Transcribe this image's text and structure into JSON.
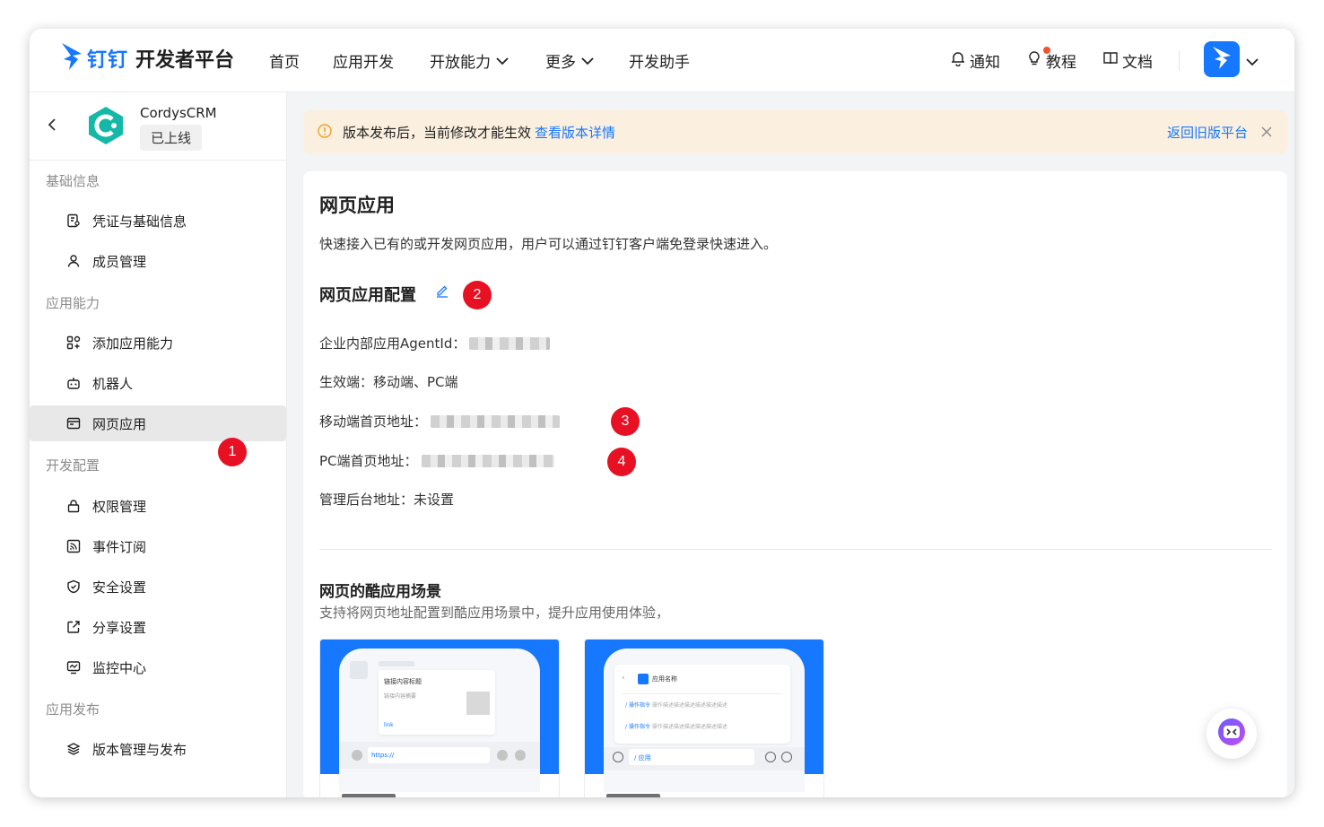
{
  "topnav": {
    "brand": "钉钉",
    "platform": "开发者平台",
    "items": [
      {
        "label": "首页"
      },
      {
        "label": "应用开发"
      },
      {
        "label": "开放能力"
      },
      {
        "label": "更多"
      },
      {
        "label": "开发助手"
      }
    ],
    "right": {
      "notify": "通知",
      "tutorial": "教程",
      "docs": "文档"
    }
  },
  "sidebar": {
    "app_name": "CordysCRM",
    "app_status": "已上线",
    "sections": [
      {
        "title": "基础信息",
        "items": [
          {
            "label": "凭证与基础信息",
            "icon": "credential-icon"
          },
          {
            "label": "成员管理",
            "icon": "user-icon"
          }
        ]
      },
      {
        "title": "应用能力",
        "items": [
          {
            "label": "添加应用能力",
            "icon": "apps-add-icon"
          },
          {
            "label": "机器人",
            "icon": "robot-icon"
          },
          {
            "label": "网页应用",
            "icon": "browser-icon"
          }
        ]
      },
      {
        "title": "开发配置",
        "items": [
          {
            "label": "权限管理",
            "icon": "lock-icon"
          },
          {
            "label": "事件订阅",
            "icon": "rss-icon"
          },
          {
            "label": "安全设置",
            "icon": "shield-icon"
          },
          {
            "label": "分享设置",
            "icon": "share-icon"
          },
          {
            "label": "监控中心",
            "icon": "monitor-icon"
          }
        ]
      },
      {
        "title": "应用发布",
        "items": [
          {
            "label": "版本管理与发布",
            "icon": "layers-icon"
          }
        ]
      }
    ],
    "active_item": "网页应用"
  },
  "notice": {
    "text": "版本发布后，当前修改才能生效",
    "link": "查看版本详情",
    "old_platform": "返回旧版平台"
  },
  "main": {
    "title": "网页应用",
    "desc": "快速接入已有的或开发网页应用，用户可以通过钉钉客户端免登录快速进入。",
    "config_title": "网页应用配置",
    "fields": {
      "agent_id_label": "企业内部应用AgentId：",
      "effective_label": "生效端：",
      "effective_value": "移动端、PC端",
      "mobile_url_label": "移动端首页地址：",
      "pc_url_label": "PC端首页地址：",
      "admin_url_label": "管理后台地址：",
      "admin_url_value": "未设置"
    },
    "scene_title": "网页的酷应用场景",
    "scene_desc": "支持将网页地址配置到酷应用场景中，提升应用使用体验，",
    "scene_cards": [
      {
        "card_title": "链接内容标题",
        "card_sub": "链接内容摘要",
        "card_link": "link",
        "input": "https://"
      },
      {
        "card_title": "应用名称",
        "cmd1": "操作指令",
        "cmd1_desc": "操作描述描述描述描述描述描述",
        "cmd2": "操作指令",
        "cmd2_desc": "操作描述描述描述描述描述描述",
        "input": "/ 应用"
      }
    ]
  },
  "badges": [
    "1",
    "2",
    "3",
    "4"
  ],
  "colors": {
    "accent": "#1677ff",
    "badge": "#e81123",
    "notice_bg": "#fbf0df"
  }
}
